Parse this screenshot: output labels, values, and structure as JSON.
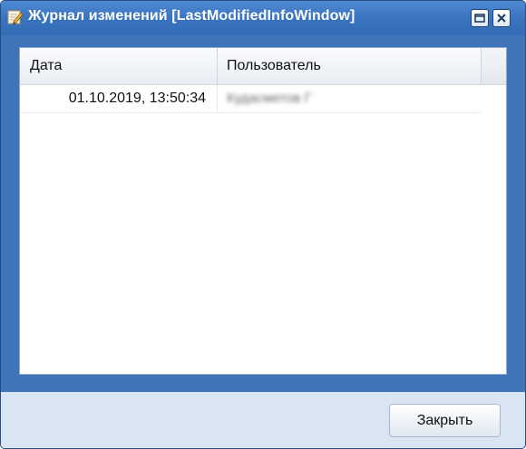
{
  "window": {
    "title": "Журнал изменений [LastModifiedInfoWindow]",
    "icon": "edit-pencil-icon",
    "controls": [
      "restore-icon",
      "close-icon"
    ]
  },
  "grid": {
    "columns": [
      "Дата",
      "Пользователь"
    ],
    "rows": [
      {
        "date": "01.10.2019, 13:50:34",
        "user": "Кудасметов Г"
      }
    ]
  },
  "footer": {
    "close_label": "Закрыть"
  },
  "colors": {
    "titlebar": "#3872bd",
    "frame": "#3f74b8",
    "footer": "#d9e5f3"
  }
}
